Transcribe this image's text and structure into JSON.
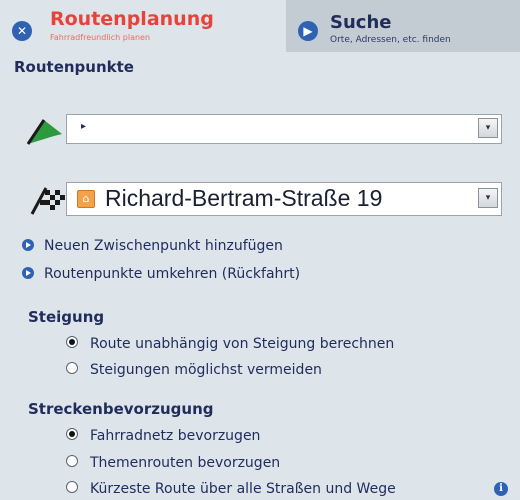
{
  "tabs": {
    "route": {
      "title": "Routenplanung",
      "subtitle": "Fahrradfreundlich planen"
    },
    "search": {
      "title": "Suche",
      "subtitle": "Orte, Adressen, etc. finden"
    }
  },
  "waypoints": {
    "heading": "Routenpunkte",
    "start_value": "",
    "end_value": "Richard-Bertram-Straße 19"
  },
  "actions": {
    "add_intermediate": "Neuen Zwischenpunkt hinzufügen",
    "reverse": "Routenpunkte umkehren (Rückfahrt)"
  },
  "incline": {
    "heading": "Steigung",
    "options": [
      {
        "label": "Route unabhängig von Steigung berechnen",
        "selected": true
      },
      {
        "label": "Steigungen möglichst vermeiden",
        "selected": false
      }
    ]
  },
  "preference": {
    "heading": "Streckenbevorzugung",
    "options": [
      {
        "label": "Fahrradnetz bevorzugen",
        "selected": true
      },
      {
        "label": "Themenrouten bevorzugen",
        "selected": false
      },
      {
        "label": "Kürzeste Route über alle Straßen und Wege",
        "selected": false
      }
    ]
  },
  "colors": {
    "accent_red": "#e8433a",
    "accent_blue": "#2f62b3",
    "text_navy": "#1f2c5c",
    "start_flag_green": "#2e9a3e"
  },
  "icons": [
    "close-icon",
    "arrow-right-icon",
    "start-flag-icon",
    "finish-flag-icon",
    "home-icon",
    "chevron-down-icon",
    "info-icon"
  ]
}
